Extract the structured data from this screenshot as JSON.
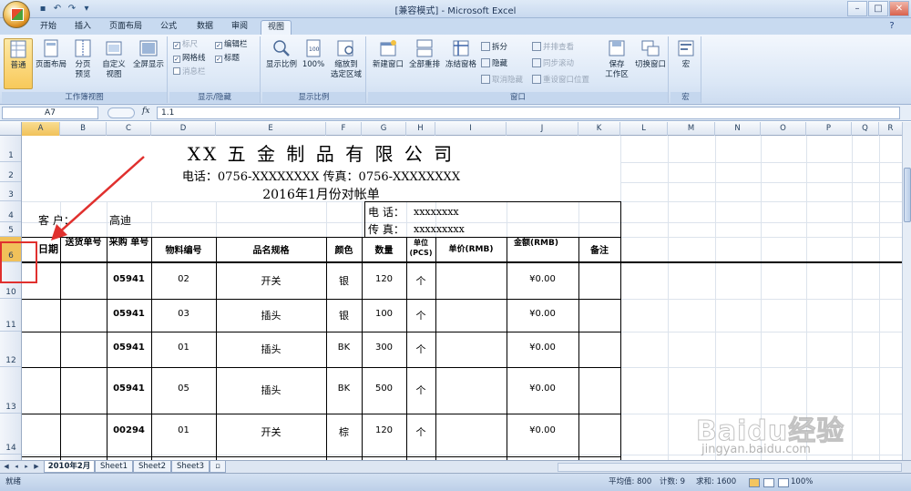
{
  "window": {
    "title": "[兼容模式] - Microsoft Excel"
  },
  "ribbon_tabs": [
    "开始",
    "插入",
    "页面布局",
    "公式",
    "数据",
    "审阅",
    "视图"
  ],
  "active_tab": "视图",
  "ribbon": {
    "workbook_views": {
      "label": "工作簿视图",
      "normal": "普通",
      "page_layout": "页面布局",
      "page_break_preview": [
        "分页",
        "预览"
      ],
      "custom_views": [
        "自定义",
        "视图"
      ],
      "full_screen": "全屏显示"
    },
    "show_hide": {
      "label": "显示/隐藏",
      "ruler": "标尺",
      "gridlines": "网格线",
      "message_bar": "消息栏",
      "formula_bar": "编辑栏",
      "headings": "标题"
    },
    "zoom": {
      "label": "显示比例",
      "zoom": "显示比例",
      "zoom_100": "100%",
      "zoom_selection": [
        "缩放到",
        "选定区域"
      ]
    },
    "window": {
      "label": "窗口",
      "new_window": "新建窗口",
      "arrange_all": "全部重排",
      "freeze_panes": "冻结窗格",
      "split": "拆分",
      "hide": "隐藏",
      "unhide": "取消隐藏",
      "side_by_side": "并排查看",
      "sync_scroll": "同步滚动",
      "reset_position": "重设窗口位置",
      "save_workspace": [
        "保存",
        "工作区"
      ],
      "switch_windows": "切换窗口"
    },
    "macros": {
      "label": "宏",
      "macros": "宏"
    }
  },
  "formula_bar": {
    "name_box": "A7",
    "fx": "fx",
    "formula": "1.1"
  },
  "columns": [
    "A",
    "B",
    "C",
    "D",
    "E",
    "F",
    "G",
    "H",
    "I",
    "J",
    "K",
    "L",
    "M",
    "N",
    "O",
    "P",
    "Q",
    "R"
  ],
  "rows": [
    "1",
    "2",
    "3",
    "4",
    "5",
    "6",
    "10",
    "11",
    "12",
    "13",
    "14"
  ],
  "sheet": {
    "company": "XX 五 金 制 品 有 限 公 司",
    "contact": "电话：0756-XXXXXXXX  传真：0756-XXXXXXXX",
    "statement_title": "2016年1月份对帐单",
    "customer_label": "客    户：",
    "customer_name": "高迪",
    "phone_label": "电  话：",
    "phone_value": "xxxxxxxx",
    "fax_label": "传  真：",
    "fax_value": "xxxxxxxxx",
    "headers": [
      "日期",
      "送货单号",
      "采购 单号",
      "物料编号",
      "品名规格",
      "颜色",
      "数量",
      "单位(PCS)",
      "单价(RMB)",
      "金额(RMB)",
      "备注"
    ],
    "rows": [
      {
        "po": "05941",
        "item": "02",
        "name": "开关",
        "color": "银",
        "qty": "120",
        "unit": "个",
        "amount": "¥0.00"
      },
      {
        "po": "05941",
        "item": "03",
        "name": "插头",
        "color": "银",
        "qty": "100",
        "unit": "个",
        "amount": "¥0.00"
      },
      {
        "po": "05941",
        "item": "01",
        "name": "插头",
        "color": "BK",
        "qty": "300",
        "unit": "个",
        "amount": "¥0.00"
      },
      {
        "po": "05941",
        "item": "05",
        "name": "插头",
        "color": "BK",
        "qty": "500",
        "unit": "个",
        "amount": "¥0.00"
      },
      {
        "po": "00294",
        "item": "01",
        "name": "开关",
        "color": "棕",
        "qty": "120",
        "unit": "个",
        "amount": "¥0.00"
      }
    ]
  },
  "sheet_tabs": [
    "2010年2月",
    "Sheet1",
    "Sheet2",
    "Sheet3"
  ],
  "active_sheet": "2010年2月",
  "status": {
    "mode": "就绪",
    "average": "平均值: 800",
    "count": "计数: 9",
    "sum": "求和: 1600",
    "zoom": "100%"
  },
  "watermark": {
    "brand": "Baidu经验",
    "url": "jingyan.baidu.com"
  },
  "colors": {
    "ribbon_bg": "#dbe7f6",
    "annotation_red": "#e0302e",
    "selection_gold": "#f1c15a"
  }
}
